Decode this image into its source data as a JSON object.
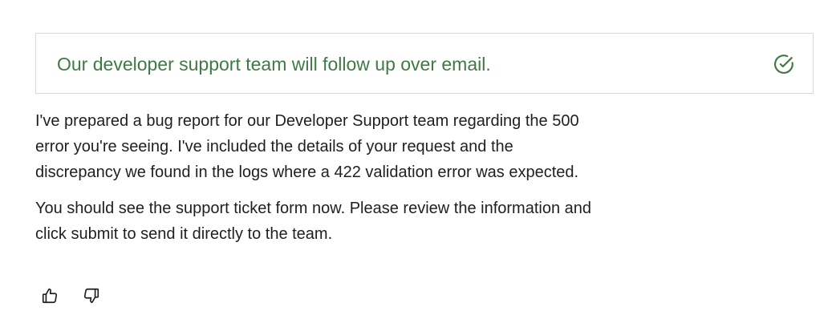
{
  "banner": {
    "text": "Our developer support team will follow up over email.",
    "icon": "check-circle-icon",
    "accent_color": "#3f7a45"
  },
  "message": {
    "paragraphs": [
      "I've prepared a bug report for our Developer Support team regarding the 500 error you're seeing. I've included the details of your request and the discrepancy we found in the logs where a 422 validation error was expected.",
      "You should see the support ticket form now. Please review the information and click submit to send it directly to the team."
    ]
  },
  "feedback": {
    "thumbs_up_icon": "thumbs-up-icon",
    "thumbs_down_icon": "thumbs-down-icon"
  }
}
